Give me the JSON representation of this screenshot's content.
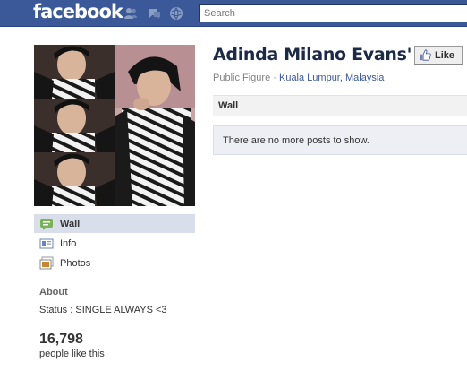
{
  "header": {
    "logo_text": "facebook",
    "search_placeholder": "Search",
    "icons": [
      "friends-icon",
      "messages-icon",
      "notifications-icon"
    ],
    "bar_color": "#3b5998"
  },
  "profile": {
    "name": "Adinda Milano Evans'",
    "category": "Public Figure",
    "separator": " · ",
    "location": "Kuala Lumpur, Malaysia",
    "like_button": "Like"
  },
  "sidebar": {
    "items": [
      {
        "label": "Wall",
        "icon": "wall-icon",
        "active": true
      },
      {
        "label": "Info",
        "icon": "info-icon",
        "active": false
      },
      {
        "label": "Photos",
        "icon": "photos-icon",
        "active": false
      }
    ],
    "about_title": "About",
    "about_text": "Status : SINGLE ALWAYS <3",
    "likes_count": "16,798",
    "likes_label": "people like this"
  },
  "wall": {
    "title": "Wall",
    "empty_message": "There are no more posts to show."
  },
  "colors": {
    "link": "#3b5998",
    "nav_active": "#d8dfea",
    "title": "#1c2a47"
  }
}
